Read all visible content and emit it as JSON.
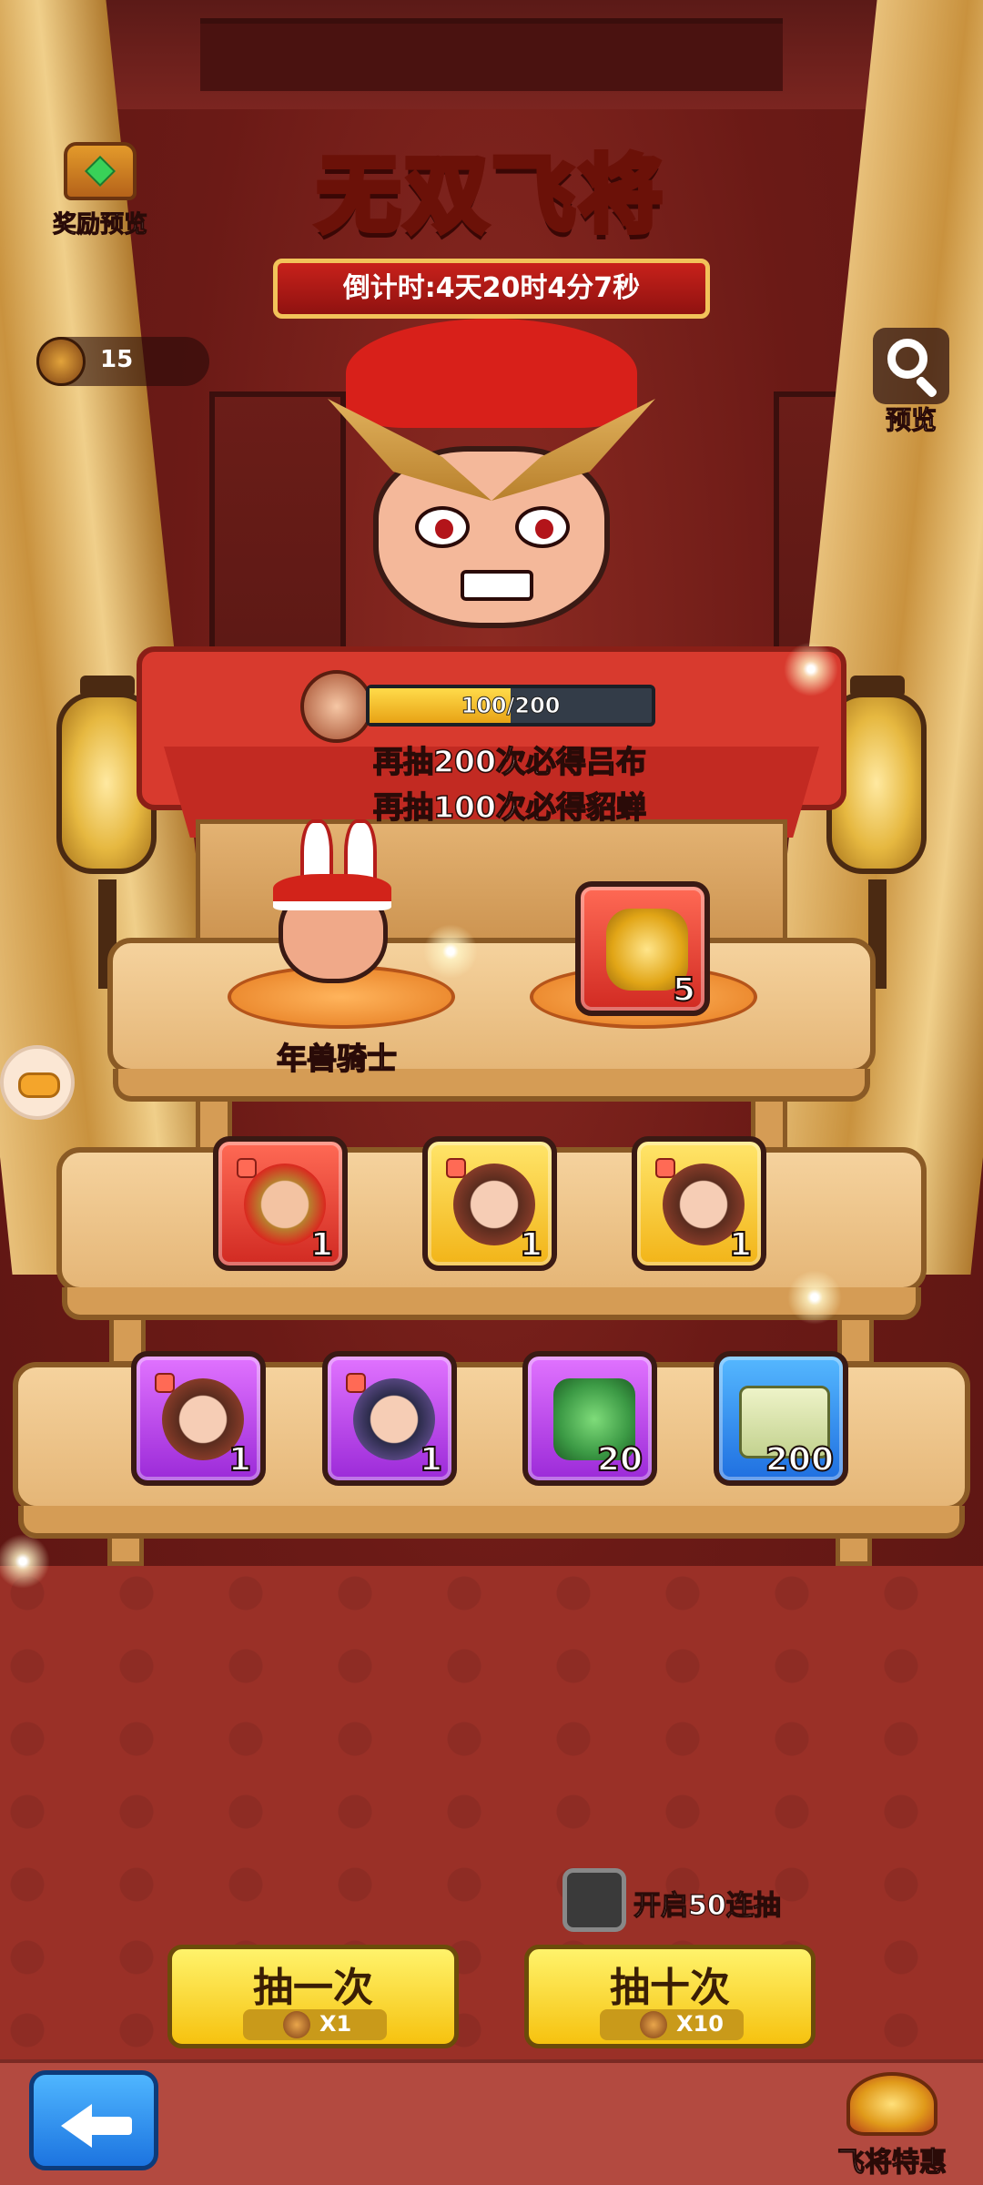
{
  "header": {
    "title": "无双飞将",
    "countdown": "倒计时:4天20时4分7秒"
  },
  "reward_preview": {
    "label": "奖励预览",
    "icon": "treasure-chest-icon"
  },
  "currency": {
    "icon": "summon-token-icon",
    "value": "15"
  },
  "preview_button": {
    "label": "预览",
    "icon": "search-icon"
  },
  "pity": {
    "progress_text": "100/200",
    "progress_fraction": 0.5,
    "line1_prefix": "再抽200次必得",
    "line1_highlight": "吕布",
    "line2_prefix": "再抽100次必得",
    "line2_highlight": "貂蝉"
  },
  "featured_character": {
    "name": "年兽骑士"
  },
  "rewards": {
    "top": [
      {
        "qty": "5",
        "rarity": "red",
        "icon": "golden-statue-icon"
      }
    ],
    "middle": [
      {
        "qty": "1",
        "rarity": "red",
        "icon": "hero-shard-icon"
      },
      {
        "qty": "1",
        "rarity": "gold",
        "icon": "hero-shard-icon"
      },
      {
        "qty": "1",
        "rarity": "gold",
        "icon": "hero-shard-icon"
      }
    ],
    "bottom": [
      {
        "qty": "1",
        "rarity": "purple",
        "icon": "hero-shard-icon"
      },
      {
        "qty": "1",
        "rarity": "purple",
        "icon": "hero-shard-icon"
      },
      {
        "qty": "20",
        "rarity": "purple",
        "icon": "jade-seal-icon"
      },
      {
        "qty": "200",
        "rarity": "blue",
        "icon": "scroll-icon"
      }
    ]
  },
  "multi_draw_toggle": {
    "label": "开启50连抽",
    "checked": false
  },
  "draw_buttons": {
    "single": {
      "label": "抽一次",
      "cost": "X1"
    },
    "ten": {
      "label": "抽十次",
      "cost": "X10"
    }
  },
  "footer": {
    "promo_label": "飞将特惠"
  },
  "colors": {
    "highlight": "#ff3b2d",
    "button_yellow": "#f6c20f",
    "back_blue": "#1c74e0"
  }
}
